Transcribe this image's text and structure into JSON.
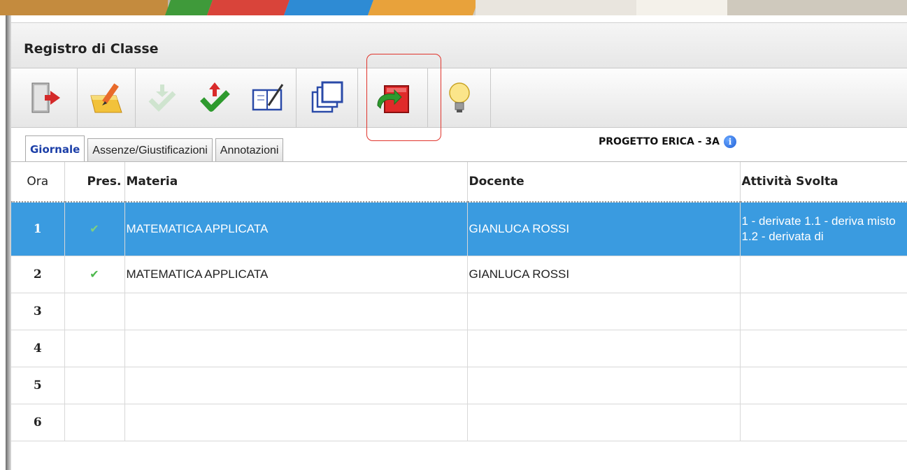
{
  "window": {
    "title": "Registro di Classe",
    "class_label": "PROGETTO ERICA - 3A"
  },
  "toolbar": {
    "buttons": [
      {
        "name": "exit-button",
        "icon": "exit-door-icon"
      },
      {
        "name": "edit-button",
        "icon": "pencil-notepad-icon"
      },
      {
        "name": "download-check-button",
        "icon": "disabled-download-check-icon"
      },
      {
        "name": "upload-check-button",
        "icon": "red-arrow-green-check-icon"
      },
      {
        "name": "book-edit-button",
        "icon": "book-pencil-icon"
      },
      {
        "name": "copy-windows-button",
        "icon": "stacked-windows-icon"
      },
      {
        "name": "redo-button",
        "icon": "red-box-green-arrow-icon"
      },
      {
        "name": "hint-button",
        "icon": "lightbulb-icon"
      }
    ],
    "highlighted": "redo-button"
  },
  "tabs": [
    {
      "label": "Giornale",
      "active": true
    },
    {
      "label": "Assenze/Giustificazioni",
      "active": false
    },
    {
      "label": "Annotazioni",
      "active": false
    }
  ],
  "table": {
    "headers": {
      "ora": "Ora",
      "pres": "Pres.",
      "materia": "Materia",
      "docente": "Docente",
      "attivita": "Attività Svolta"
    },
    "rows": [
      {
        "ora": "1",
        "pres": "✔",
        "materia": "MATEMATICA APPLICATA",
        "docente": "GIANLUCA ROSSI",
        "attivita": "1 - derivate 1.1 - deriva misto 1.2 - derivata di",
        "selected": true
      },
      {
        "ora": "2",
        "pres": "✔",
        "materia": "MATEMATICA APPLICATA",
        "docente": "GIANLUCA ROSSI",
        "attivita": "",
        "selected": false
      },
      {
        "ora": "3",
        "pres": "",
        "materia": "",
        "docente": "",
        "attivita": "",
        "selected": false
      },
      {
        "ora": "4",
        "pres": "",
        "materia": "",
        "docente": "",
        "attivita": "",
        "selected": false
      },
      {
        "ora": "5",
        "pres": "",
        "materia": "",
        "docente": "",
        "attivita": "",
        "selected": false
      },
      {
        "ora": "6",
        "pres": "",
        "materia": "",
        "docente": "",
        "attivita": "",
        "selected": false
      }
    ]
  },
  "colors": {
    "selected_row": "#3a9be0",
    "check": "#4cb84c",
    "active_tab_text": "#1c3fa8",
    "highlight_box": "#e0342c"
  }
}
